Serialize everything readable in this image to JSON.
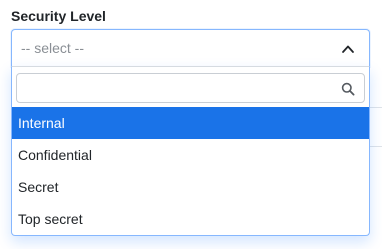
{
  "field": {
    "label": "Security Level",
    "placeholder": "-- select --"
  },
  "dropdown": {
    "search_value": "",
    "options": [
      {
        "label": "Internal",
        "highlighted": true
      },
      {
        "label": "Confidential",
        "highlighted": false
      },
      {
        "label": "Secret",
        "highlighted": false
      },
      {
        "label": "Top secret",
        "highlighted": false
      }
    ]
  },
  "icons": {
    "toggle": "chevron-up-icon",
    "search": "search-icon"
  },
  "colors": {
    "highlight": "#1a73e8",
    "focus_border": "#86b7fe",
    "placeholder": "#8a8f95"
  }
}
